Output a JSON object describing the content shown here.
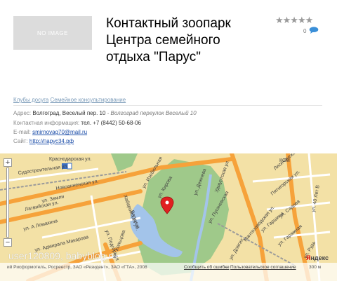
{
  "header": {
    "noimage_label": "NO IMAGE",
    "title": "Контактный зоопарк Центра семейного отдыха \"Парус\"",
    "rating_stars": "★★★★★",
    "comments_count": "0"
  },
  "categories": [
    "Клубы досуга",
    "Семейное консультирование"
  ],
  "info": {
    "address_label": "Адрес:",
    "address_value": "Волгоград, Веселый пер. 10",
    "address_extra": "- Волгоград переулок Веселый 10",
    "contact_label": "Контактная информация:",
    "contact_value": "тел. +7 (8442) 50-68-06",
    "email_label": "E-mail:",
    "email_value": "smirnovag70@mail.ru",
    "site_label": "Сайт:",
    "site_value": "http://парус34.рф"
  },
  "map": {
    "streets": [
      "Краснодарская ул.",
      "Судостроительная ул.",
      "Новоанненская ул.",
      "Латвийская ул.",
      "ул. Земли",
      "ул. А Ломакина",
      "ул. Адмирала Макарова",
      "ул. Изобильная",
      "ул. Кирова",
      "Вялкина",
      "Хабаровская ул.",
      "ул. Подгорная",
      "ул. Кольцова",
      "ул. Дежнева",
      "Удмуртская ул.",
      "ул. Пугачевская",
      "Пятигорская ул.",
      "ул. Садова",
      "Мачтозаводская ул.",
      "ул. Гаражная",
      "ул. 40 Лет В",
      "ул. Рудь",
      "ул. Гаршина",
      "ул. Довгих",
      "Лисичанская ул.",
      "КСМ"
    ],
    "zoom_in": "+",
    "zoom_out": "−",
    "logo_ya": "Я",
    "logo_rest": "ндекс",
    "footer_left": "ий Рисформотелъ, Росреестр, ЗАО «Резидент», ЗАО «ГТА», 2008",
    "footer_report": "Сообщить об ошибке",
    "footer_terms": "Пользовательское соглашение",
    "footer_scale": "300 м"
  },
  "watermark": "user120809, babyblog.ru",
  "colors": {
    "park": "#9fc98a",
    "water": "#a3c4ea",
    "road_major": "#f6a23a",
    "road_minor": "#ffffff",
    "rail": "#9a9a9a",
    "marker": "#e02020"
  }
}
